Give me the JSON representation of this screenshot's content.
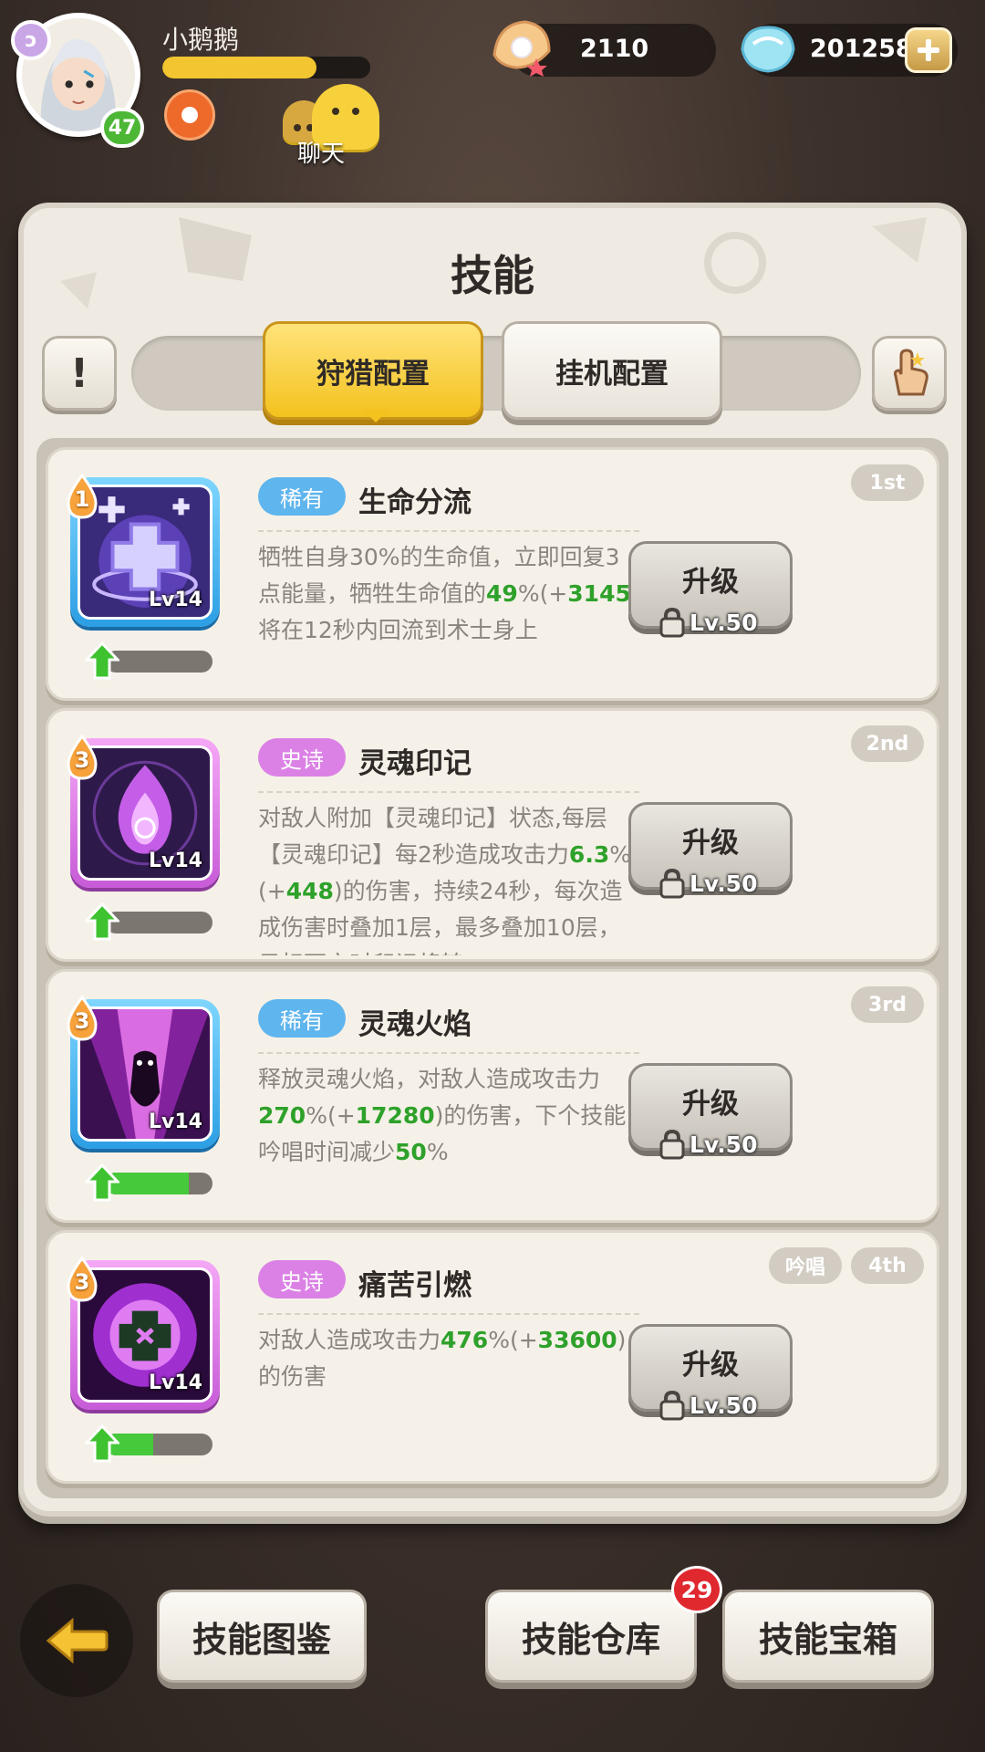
{
  "player": {
    "name": "小鹅鹅",
    "level": "47",
    "xp_fraction": 0.74,
    "chat_label": "聊天"
  },
  "currency": {
    "shells": "2110",
    "gems": "201258"
  },
  "panel": {
    "title": "技能",
    "info_label": "!",
    "tabs": [
      {
        "label": "狩猎配置",
        "active": true
      },
      {
        "label": "挂机配置",
        "active": false
      }
    ]
  },
  "skills": [
    {
      "order": "1",
      "rarity": "稀有",
      "rarity_type": "rare",
      "name": "生命分流",
      "level": "Lv14",
      "rank": "1st",
      "progress": 0.0,
      "desc_parts": [
        {
          "t": "牺牲自身30%的生命值，立即回复3点能量，牺牲生命值的",
          "hl": false
        },
        {
          "t": "49",
          "hl": true
        },
        {
          "t": "%(+",
          "hl": false
        },
        {
          "t": "3145",
          "hl": true
        },
        {
          "t": ")将在12秒内回流到术士身上",
          "hl": false
        }
      ],
      "upgrade_label": "升级",
      "required_level": "Lv.50"
    },
    {
      "order": "3",
      "rarity": "史诗",
      "rarity_type": "epic",
      "name": "灵魂印记",
      "level": "Lv14",
      "rank": "2nd",
      "progress": 0.0,
      "desc_parts": [
        {
          "t": "对敌人附加【灵魂印记】状态,每层【灵魂印记】每2秒造成攻击力",
          "hl": false
        },
        {
          "t": "6.3",
          "hl": true
        },
        {
          "t": "%(+",
          "hl": false
        },
        {
          "t": "448",
          "hl": true
        },
        {
          "t": ")的伤害，持续24秒，每次造成伤害时叠加1层，最多叠加10层，目标死亡时印记将转",
          "hl": false
        }
      ],
      "upgrade_label": "升级",
      "required_level": "Lv.50"
    },
    {
      "order": "3",
      "rarity": "稀有",
      "rarity_type": "rare",
      "name": "灵魂火焰",
      "level": "Lv14",
      "rank": "3rd",
      "progress": 0.78,
      "desc_parts": [
        {
          "t": "释放灵魂火焰，对敌人造成攻击力",
          "hl": false
        },
        {
          "t": "270",
          "hl": true
        },
        {
          "t": "%(+",
          "hl": false
        },
        {
          "t": "17280",
          "hl": true
        },
        {
          "t": ")的伤害，下个技能吟唱时间减少",
          "hl": false
        },
        {
          "t": "50",
          "hl": true
        },
        {
          "t": "%",
          "hl": false
        }
      ],
      "upgrade_label": "升级",
      "required_level": "Lv.50"
    },
    {
      "order": "3",
      "rarity": "史诗",
      "rarity_type": "epic",
      "name": "痛苦引燃",
      "level": "Lv14",
      "rank": "4th",
      "chant": "吟唱",
      "progress": 0.45,
      "desc_parts": [
        {
          "t": "对敌人造成攻击力",
          "hl": false
        },
        {
          "t": "476",
          "hl": true
        },
        {
          "t": "%(+",
          "hl": false
        },
        {
          "t": "33600",
          "hl": true
        },
        {
          "t": ")的伤害",
          "hl": false
        }
      ],
      "upgrade_label": "升级",
      "required_level": "Lv.50"
    }
  ],
  "bottom": {
    "codex": "技能图鉴",
    "storage": "技能仓库",
    "storage_badge": "29",
    "chest": "技能宝箱"
  },
  "colors": {
    "highlight_green": "#2ea12a",
    "tab_active": "#f4c21e",
    "rare": "#5fb5ee",
    "epic": "#db81e6",
    "badge_red": "#e0282f"
  }
}
